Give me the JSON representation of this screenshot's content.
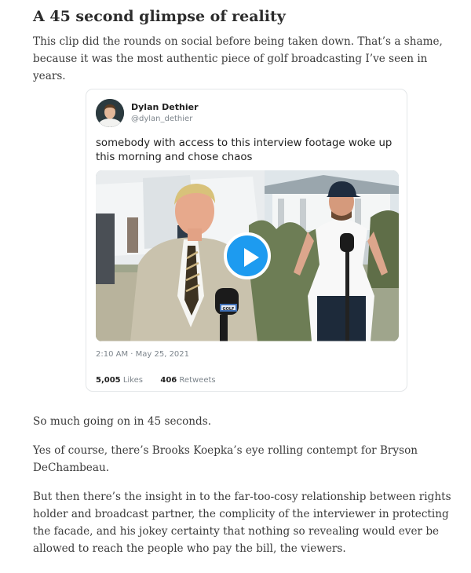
{
  "article": {
    "title": "A 45 second glimpse of reality",
    "intro": "This clip did the rounds on social before being taken down. That’s a shame, because it was the most authentic piece of golf broadcasting I’ve seen in years.",
    "paragraphs": [
      "So much going on in 45 seconds.",
      "Yes of course, there’s Brooks Koepka’s eye rolling contempt for Bryson DeChambeau.",
      "But then there’s the insight in to the far-too-cosy relationship between rights holder and broadcast partner, the complicity of the interviewer in protecting the facade, and his jokey certainty that nothing so revealing would ever be allowed to reach the people who pay the bill, the viewers."
    ]
  },
  "tweet": {
    "author_name": "Dylan Dethier",
    "author_handle": "@dylan_dethier",
    "text": "somebody with access to this interview footage woke up this morning and chose chaos",
    "timestamp": "2:10 AM · May 25, 2021",
    "likes_count": "5,005",
    "likes_label": "Likes",
    "retweets_count": "406",
    "retweets_label": "Retweets",
    "mic_label": "GOLF",
    "icons": {
      "play": "play-icon",
      "avatar": "avatar-portrait"
    },
    "colors": {
      "play_button": "#1d9bf0"
    }
  }
}
